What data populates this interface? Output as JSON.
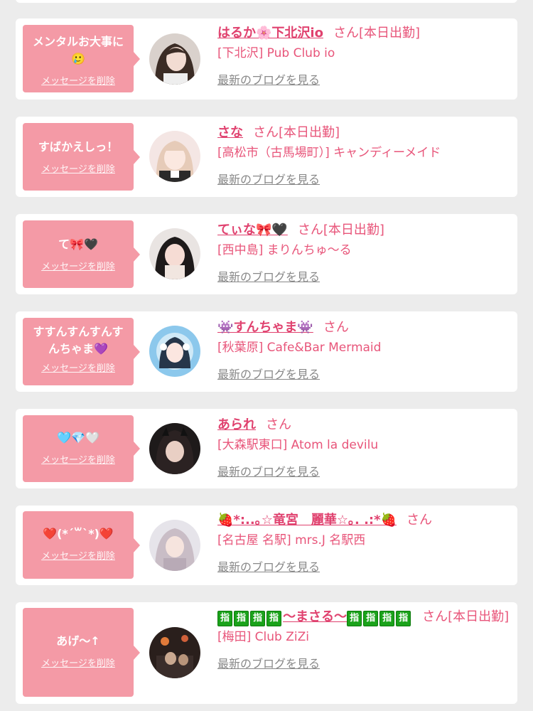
{
  "delete_label": "メッセージを削除",
  "blog_label": "最新のブログを見る",
  "colors": {
    "accent": "#e0426f",
    "bubble": "#f49aa6",
    "background": "#ececec"
  },
  "entries": [
    {
      "bubble_text": "メンタルお大事に🥲",
      "name": "はるか🌸下北沢io",
      "suffix": "さん[本日出勤]",
      "shop": "[下北沢] Pub Club io"
    },
    {
      "bubble_text": "すばかえしっ！",
      "name": "さな",
      "suffix": "さん[本日出勤]",
      "shop": "[高松市（古馬場町）] キャンディーメイド"
    },
    {
      "bubble_text": "て🎀🖤",
      "name": "てぃな🎀🖤",
      "suffix": "さん[本日出勤]",
      "shop": "[西中島] まりんちゅ〜る"
    },
    {
      "bubble_text": "すすんすんすんすんちゃま💜",
      "name": "👾すんちゃま👾",
      "suffix": "さん",
      "shop": "[秋葉原] Cafe&Bar Mermaid"
    },
    {
      "bubble_text": "🩵💎🤍",
      "name": "あられ",
      "suffix": "さん",
      "shop": "[大森駅東口] Atom la devilu"
    },
    {
      "bubble_text": "❤️(*´꒳`*)❤️",
      "name": "🍓*:..｡☆竜宮　麗華☆｡. .:*🍓",
      "suffix": "さん",
      "shop": "[名古屋 名駅] mrs.J 名駅西"
    },
    {
      "bubble_text": "あげ〜↑",
      "name_boxes_left": [
        "指",
        "指",
        "指",
        "指"
      ],
      "name_mid": "〜まさる〜",
      "name_boxes_right": [
        "指",
        "指",
        "指",
        "指"
      ],
      "suffix": "さん[本日出勤]",
      "shop": "[梅田] Club ZiZi"
    }
  ]
}
